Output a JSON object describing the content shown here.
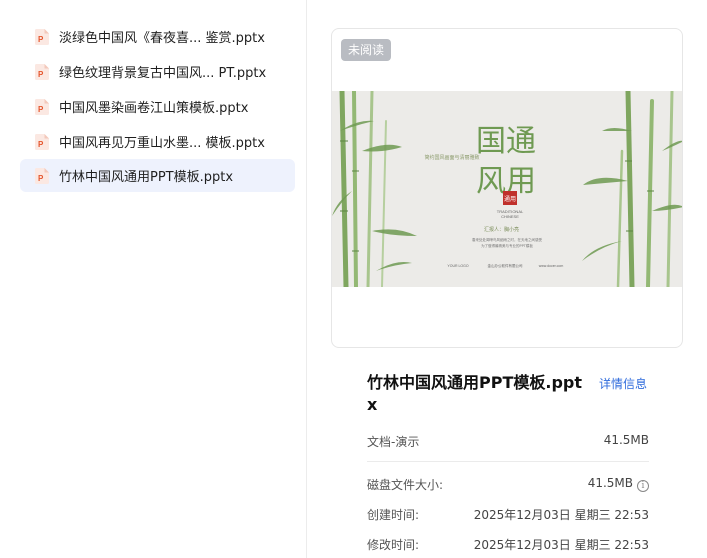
{
  "files": [
    {
      "name": "淡绿色中国风《春夜喜... 鉴赏.pptx",
      "selected": false
    },
    {
      "name": "绿色纹理背景复古中国风... PT.pptx",
      "selected": false
    },
    {
      "name": "中国风墨染画卷江山策模板.pptx",
      "selected": false
    },
    {
      "name": "中国风再见万重山水墨... 模板.pptx",
      "selected": false
    },
    {
      "name": "竹林中国风通用PPT模板.pptx",
      "selected": true
    }
  ],
  "preview": {
    "badge": "未阅读",
    "slide": {
      "title_line1": "国通",
      "title_line2": "风用",
      "seal": "通用",
      "subtitle": "简约国风画面与清丽雅致",
      "traditional": "TRADITIONAL",
      "chinese": "CHINESE",
      "reporter": "汇报人：胸小亮",
      "desc_line1": "春来处处闻啼鸟风细雨之时，在天地之间感受",
      "desc_line2": "为了做得最精美与专业的PPT模板",
      "footer_logo": "YOUR LOGO",
      "footer_company": "金山办公软件有限公司",
      "footer_url": "www.docer.com"
    }
  },
  "details": {
    "title": "竹林中国风通用PPT模板.pptx",
    "details_link": "详情信息",
    "rows": [
      {
        "label": "文档-演示",
        "value": "41.5MB"
      },
      {
        "label": "磁盘文件大小:",
        "value": "41.5MB"
      },
      {
        "label": "创建时间:",
        "value": "2025年12月03日 星期三 22:53"
      },
      {
        "label": "修改时间:",
        "value": "2025年12月03日 星期三 22:53"
      }
    ]
  },
  "colors": {
    "accent": "#2f6bdc",
    "selected_bg": "#eef2fd",
    "ppt_icon": "#e5552d",
    "bamboo": "#6f9a52",
    "seal_red": "#c0302b"
  }
}
